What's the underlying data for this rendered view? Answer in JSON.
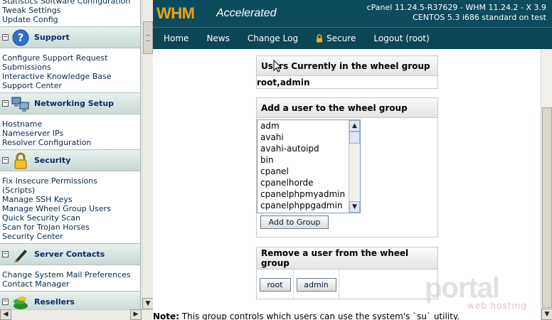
{
  "sidebar": {
    "top_links": [
      "Statistics Software Configuration",
      "Tweak Settings",
      "Update Config"
    ],
    "sections": [
      {
        "title": "Support",
        "links": [
          "Configure Support Request",
          "Submissions",
          "Interactive Knowledge Base",
          "Support Center"
        ]
      },
      {
        "title": "Networking Setup",
        "links": [
          "Hostname",
          "Nameserver IPs",
          "Resolver Configuration"
        ]
      },
      {
        "title": "Security",
        "links": [
          "Fix Insecure Permissions",
          "(Scripts)",
          "Manage SSH Keys",
          "Manage Wheel Group Users",
          "Quick Security Scan",
          "Scan for Trojan Horses",
          "Security Center"
        ]
      },
      {
        "title": "Server Contacts",
        "links": [
          "Change System Mail Preferences",
          "Contact Manager"
        ]
      },
      {
        "title": "Resellers",
        "links": []
      }
    ]
  },
  "header": {
    "logo_main": "WHM",
    "logo_sub": "Accelerated",
    "version_line1": "cPanel 11.24.5-R37629 - WHM 11.24.2 - X 3.9",
    "version_line2": "CENTOS 5.3 i686 standard on test"
  },
  "nav": {
    "items": [
      "Home",
      "News",
      "Change Log",
      "Secure",
      "Logout (root)"
    ]
  },
  "main": {
    "current_box": {
      "title": "Users Currently in the wheel group",
      "value": "root,admin"
    },
    "add_box": {
      "title": "Add a user to the wheel group",
      "options": [
        "adm",
        "avahi",
        "avahi-autoipd",
        "bin",
        "cpanel",
        "cpanelhorde",
        "cpanelphpmyadmin",
        "cpanelphppgadmin"
      ],
      "button": "Add to Group"
    },
    "remove_box": {
      "title": "Remove a user from the wheel group",
      "buttons": [
        "root",
        "admin"
      ]
    },
    "note_label": "Note:",
    "note_text": " This group controls which users can use the system's `su` utility."
  },
  "watermark": {
    "brand": "portal",
    "tagline": "web hosting"
  },
  "colors": {
    "header_bg": "#0c4b5c",
    "logo_orange": "#f2a20c",
    "section_title": "#0d2a66"
  }
}
